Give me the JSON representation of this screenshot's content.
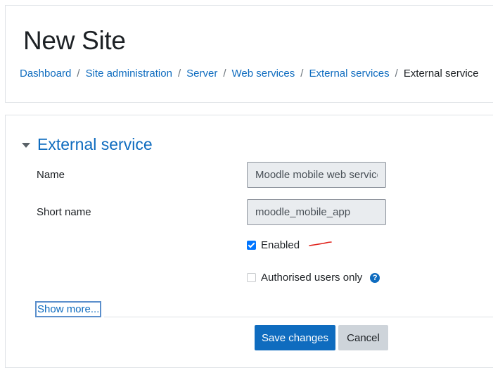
{
  "page": {
    "site_title": "New Site"
  },
  "breadcrumb": {
    "items": [
      "Dashboard",
      "Site administration",
      "Server",
      "Web services",
      "External services"
    ],
    "separator": "/",
    "current": "External service"
  },
  "form": {
    "section_title": "External service",
    "name": {
      "label": "Name",
      "value": "Moodle mobile web service"
    },
    "short_name": {
      "label": "Short name",
      "value": "moodle_mobile_app"
    },
    "enabled": {
      "label": "Enabled",
      "checked": true
    },
    "authorised_users_only": {
      "label": "Authorised users only",
      "checked": false
    },
    "help_icon_glyph": "?",
    "show_more_label": "Show more...",
    "save_label": "Save changes",
    "cancel_label": "Cancel"
  },
  "colors": {
    "link": "#0f6cbf",
    "primary_button": "#0f6cbf",
    "secondary_button": "#ced4da",
    "checkbox_checked": "#0075ff",
    "annotation_mark": "#e0231c"
  },
  "icons": [
    "section-collapse-caret-icon",
    "help-icon",
    "checkbox-checked-icon"
  ]
}
